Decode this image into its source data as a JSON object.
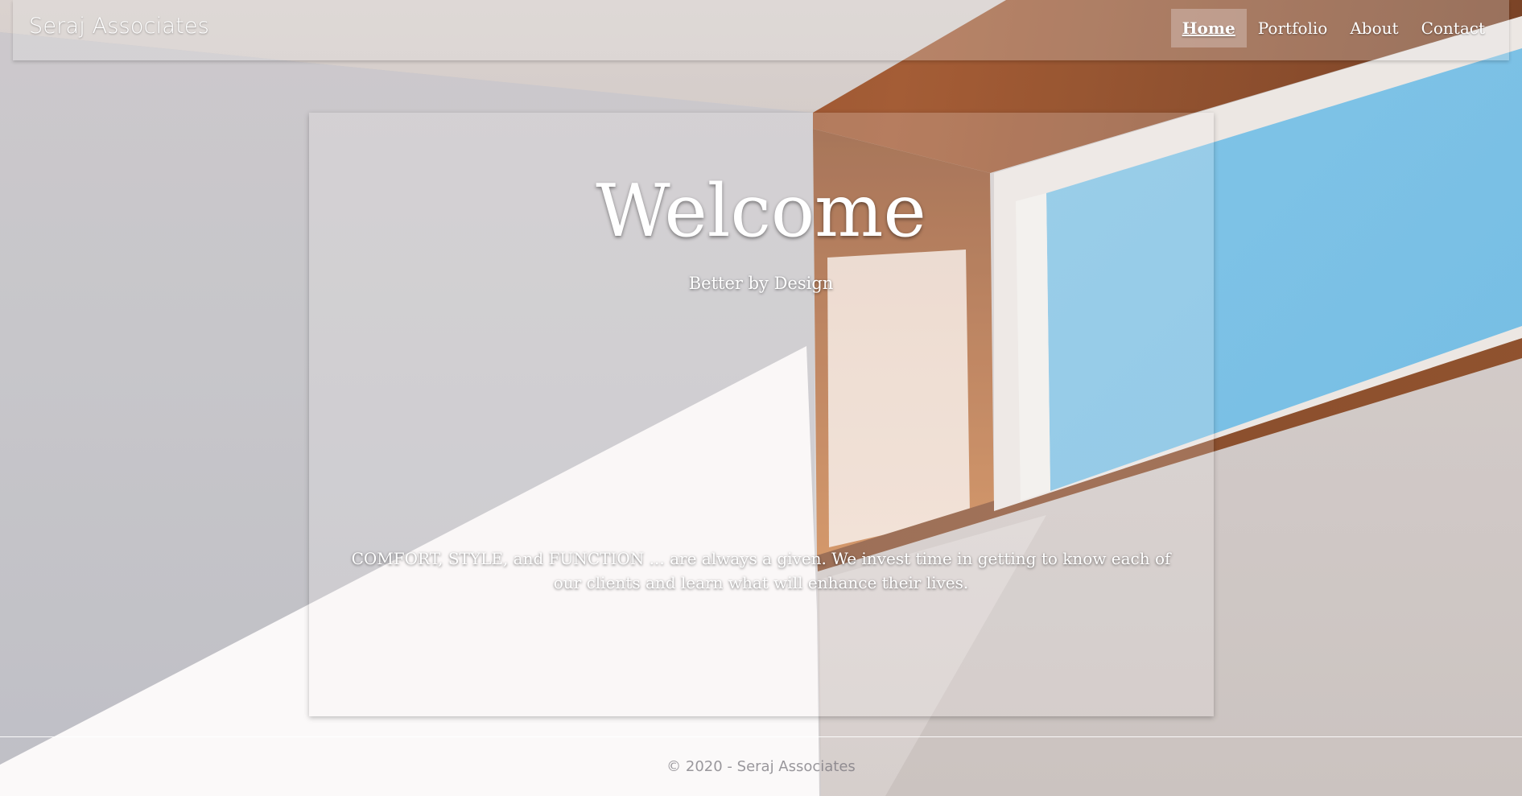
{
  "navbar": {
    "brand": "Seraj Associates",
    "links": [
      {
        "label": "Home",
        "active": true
      },
      {
        "label": "Portfolio",
        "active": false
      },
      {
        "label": "About",
        "active": false
      },
      {
        "label": "Contact",
        "active": false
      }
    ]
  },
  "hero": {
    "title": "Welcome",
    "subtitle": "Better by Design",
    "body": "COMFORT, STYLE, and FUNCTION ... are always a given. We invest time in getting to know each of our clients and learn what will enhance their lives."
  },
  "footer": {
    "text": "© 2020 - Seraj Associates"
  },
  "colors": {
    "text": "#ffffff",
    "footer_text": "#78767c",
    "sky": "#6ab8e2",
    "wood": "#a0552c"
  }
}
